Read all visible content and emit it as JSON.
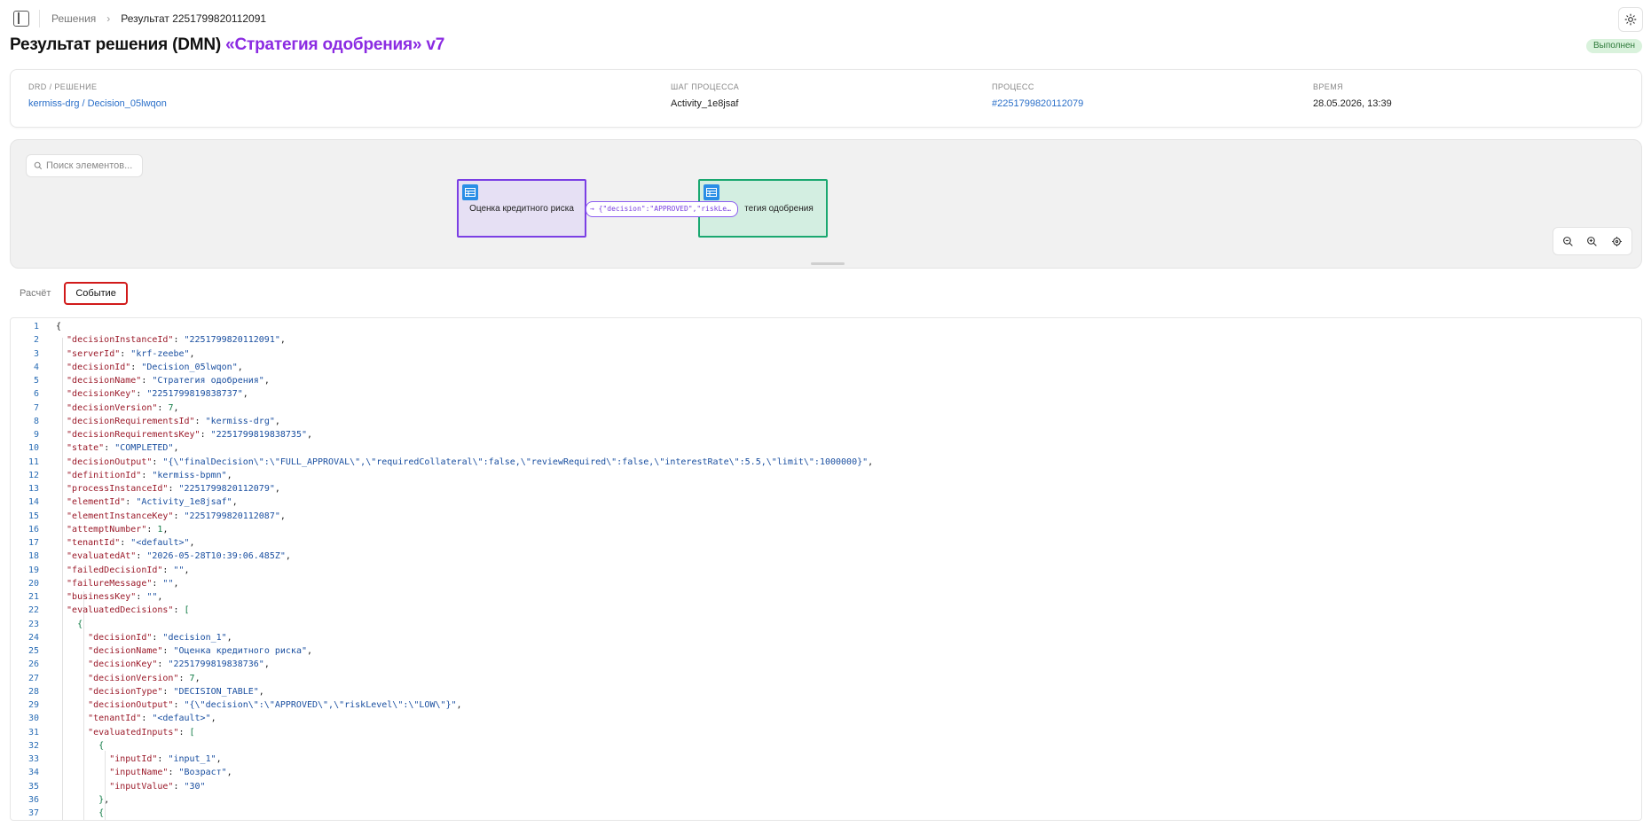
{
  "breadcrumb": {
    "root": "Решения",
    "current": "Результат 2251799820112091"
  },
  "header": {
    "title": "Результат решения (DMN)",
    "title_accent": "«Стратегия одобрения» v7",
    "status": "Выполнен"
  },
  "meta": [
    {
      "label": "DRD / РЕШЕНИЕ",
      "value": "kermiss-drg / Decision_05lwqon",
      "is_link": true
    },
    {
      "label": "ШАГ ПРОЦЕССА",
      "value": "Activity_1e8jsaf",
      "is_link": false
    },
    {
      "label": "ПРОЦЕСС",
      "value": "#2251799820112079",
      "is_link": true
    },
    {
      "label": "ВРЕМЯ",
      "value": "28.05.2026, 13:39",
      "is_link": false
    }
  ],
  "diagram": {
    "search_placeholder": "Поиск элементов...",
    "node_a": "Оценка кредитного риска",
    "node_b": "тегия одобрения",
    "edge_label": "→ {\"decision\":\"APPROVED\",\"riskLe…"
  },
  "tabs": [
    {
      "label": "Расчёт",
      "active": false
    },
    {
      "label": "Событие",
      "active": true
    }
  ],
  "code_lines": [
    [
      [
        "p",
        "{"
      ]
    ],
    [
      [
        "k",
        "  \"decisionInstanceId\""
      ],
      [
        "p",
        ": "
      ],
      [
        "s",
        "\"2251799820112091\""
      ],
      [
        "p",
        ","
      ]
    ],
    [
      [
        "k",
        "  \"serverId\""
      ],
      [
        "p",
        ": "
      ],
      [
        "s",
        "\"krf-zeebe\""
      ],
      [
        "p",
        ","
      ]
    ],
    [
      [
        "k",
        "  \"decisionId\""
      ],
      [
        "p",
        ": "
      ],
      [
        "s",
        "\"Decision_05lwqon\""
      ],
      [
        "p",
        ","
      ]
    ],
    [
      [
        "k",
        "  \"decisionName\""
      ],
      [
        "p",
        ": "
      ],
      [
        "s",
        "\"Стратегия одобрения\""
      ],
      [
        "p",
        ","
      ]
    ],
    [
      [
        "k",
        "  \"decisionKey\""
      ],
      [
        "p",
        ": "
      ],
      [
        "s",
        "\"2251799819838737\""
      ],
      [
        "p",
        ","
      ]
    ],
    [
      [
        "k",
        "  \"decisionVersion\""
      ],
      [
        "p",
        ": "
      ],
      [
        "n",
        "7"
      ],
      [
        "p",
        ","
      ]
    ],
    [
      [
        "k",
        "  \"decisionRequirementsId\""
      ],
      [
        "p",
        ": "
      ],
      [
        "s",
        "\"kermiss-drg\""
      ],
      [
        "p",
        ","
      ]
    ],
    [
      [
        "k",
        "  \"decisionRequirementsKey\""
      ],
      [
        "p",
        ": "
      ],
      [
        "s",
        "\"2251799819838735\""
      ],
      [
        "p",
        ","
      ]
    ],
    [
      [
        "k",
        "  \"state\""
      ],
      [
        "p",
        ": "
      ],
      [
        "s",
        "\"COMPLETED\""
      ],
      [
        "p",
        ","
      ]
    ],
    [
      [
        "k",
        "  \"decisionOutput\""
      ],
      [
        "p",
        ": "
      ],
      [
        "s",
        "\"{\\\"finalDecision\\\":\\\"FULL_APPROVAL\\\",\\\"requiredCollateral\\\":false,\\\"reviewRequired\\\":false,\\\"interestRate\\\":5.5,\\\"limit\\\":1000000}\""
      ],
      [
        "p",
        ","
      ]
    ],
    [
      [
        "k",
        "  \"definitionId\""
      ],
      [
        "p",
        ": "
      ],
      [
        "s",
        "\"kermiss-bpmn\""
      ],
      [
        "p",
        ","
      ]
    ],
    [
      [
        "k",
        "  \"processInstanceId\""
      ],
      [
        "p",
        ": "
      ],
      [
        "s",
        "\"2251799820112079\""
      ],
      [
        "p",
        ","
      ]
    ],
    [
      [
        "k",
        "  \"elementId\""
      ],
      [
        "p",
        ": "
      ],
      [
        "s",
        "\"Activity_1e8jsaf\""
      ],
      [
        "p",
        ","
      ]
    ],
    [
      [
        "k",
        "  \"elementInstanceKey\""
      ],
      [
        "p",
        ": "
      ],
      [
        "s",
        "\"2251799820112087\""
      ],
      [
        "p",
        ","
      ]
    ],
    [
      [
        "k",
        "  \"attemptNumber\""
      ],
      [
        "p",
        ": "
      ],
      [
        "n",
        "1"
      ],
      [
        "p",
        ","
      ]
    ],
    [
      [
        "k",
        "  \"tenantId\""
      ],
      [
        "p",
        ": "
      ],
      [
        "s",
        "\"<default>\""
      ],
      [
        "p",
        ","
      ]
    ],
    [
      [
        "k",
        "  \"evaluatedAt\""
      ],
      [
        "p",
        ": "
      ],
      [
        "s",
        "\"2026-05-28T10:39:06.485Z\""
      ],
      [
        "p",
        ","
      ]
    ],
    [
      [
        "k",
        "  \"failedDecisionId\""
      ],
      [
        "p",
        ": "
      ],
      [
        "s",
        "\"\""
      ],
      [
        "p",
        ","
      ]
    ],
    [
      [
        "k",
        "  \"failureMessage\""
      ],
      [
        "p",
        ": "
      ],
      [
        "s",
        "\"\""
      ],
      [
        "p",
        ","
      ]
    ],
    [
      [
        "k",
        "  \"businessKey\""
      ],
      [
        "p",
        ": "
      ],
      [
        "s",
        "\"\""
      ],
      [
        "p",
        ","
      ]
    ],
    [
      [
        "k",
        "  \"evaluatedDecisions\""
      ],
      [
        "p",
        ": "
      ],
      [
        "n",
        "["
      ]
    ],
    [
      [
        "n",
        "    {"
      ]
    ],
    [
      [
        "k",
        "      \"decisionId\""
      ],
      [
        "p",
        ": "
      ],
      [
        "s",
        "\"decision_1\""
      ],
      [
        "p",
        ","
      ]
    ],
    [
      [
        "k",
        "      \"decisionName\""
      ],
      [
        "p",
        ": "
      ],
      [
        "s",
        "\"Оценка кредитного риска\""
      ],
      [
        "p",
        ","
      ]
    ],
    [
      [
        "k",
        "      \"decisionKey\""
      ],
      [
        "p",
        ": "
      ],
      [
        "s",
        "\"2251799819838736\""
      ],
      [
        "p",
        ","
      ]
    ],
    [
      [
        "k",
        "      \"decisionVersion\""
      ],
      [
        "p",
        ": "
      ],
      [
        "n",
        "7"
      ],
      [
        "p",
        ","
      ]
    ],
    [
      [
        "k",
        "      \"decisionType\""
      ],
      [
        "p",
        ": "
      ],
      [
        "s",
        "\"DECISION_TABLE\""
      ],
      [
        "p",
        ","
      ]
    ],
    [
      [
        "k",
        "      \"decisionOutput\""
      ],
      [
        "p",
        ": "
      ],
      [
        "s",
        "\"{\\\"decision\\\":\\\"APPROVED\\\",\\\"riskLevel\\\":\\\"LOW\\\"}\""
      ],
      [
        "p",
        ","
      ]
    ],
    [
      [
        "k",
        "      \"tenantId\""
      ],
      [
        "p",
        ": "
      ],
      [
        "s",
        "\"<default>\""
      ],
      [
        "p",
        ","
      ]
    ],
    [
      [
        "k",
        "      \"evaluatedInputs\""
      ],
      [
        "p",
        ": "
      ],
      [
        "n",
        "["
      ]
    ],
    [
      [
        "n",
        "        {"
      ]
    ],
    [
      [
        "k",
        "          \"inputId\""
      ],
      [
        "p",
        ": "
      ],
      [
        "s",
        "\"input_1\""
      ],
      [
        "p",
        ","
      ]
    ],
    [
      [
        "k",
        "          \"inputName\""
      ],
      [
        "p",
        ": "
      ],
      [
        "s",
        "\"Возраст\""
      ],
      [
        "p",
        ","
      ]
    ],
    [
      [
        "k",
        "          \"inputValue\""
      ],
      [
        "p",
        ": "
      ],
      [
        "s",
        "\"30\""
      ]
    ],
    [
      [
        "n",
        "        }"
      ],
      [
        "p",
        ","
      ]
    ],
    [
      [
        "n",
        "        {"
      ]
    ]
  ]
}
